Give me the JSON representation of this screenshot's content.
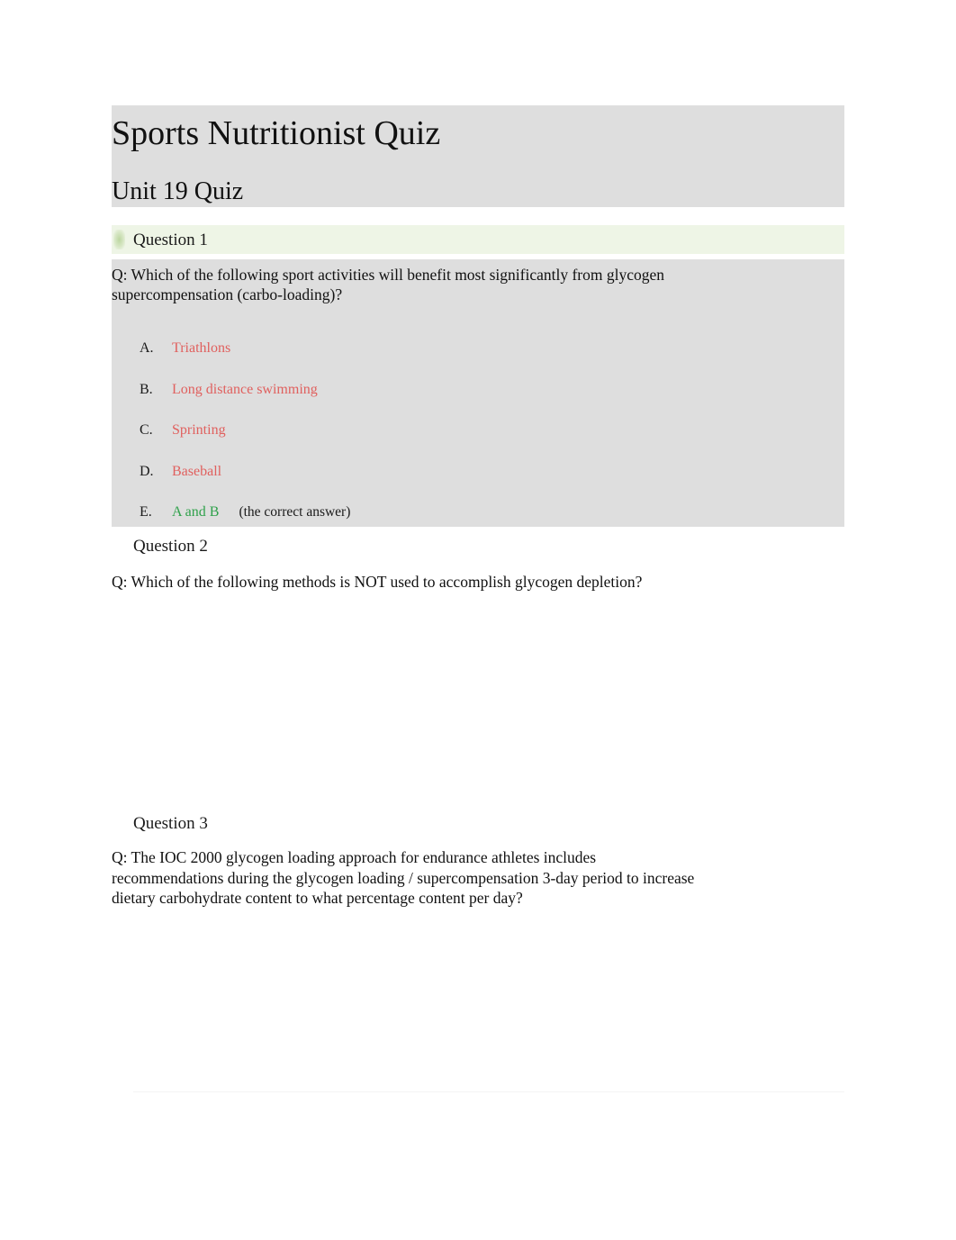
{
  "document": {
    "title": "Sports Nutritionist Quiz",
    "subtitle": "Unit 19 Quiz"
  },
  "questions": [
    {
      "heading": "Question 1",
      "prompt": "Q:  Which of the following sport activities will benefit most significantly from glycogen supercompensation (carbo-loading)?",
      "options": [
        {
          "letter": "A.",
          "text": "Triathlons",
          "correct": false,
          "note": ""
        },
        {
          "letter": "B.",
          "text": "Long distance swimming",
          "correct": false,
          "note": ""
        },
        {
          "letter": "C.",
          "text": "Sprinting",
          "correct": false,
          "note": ""
        },
        {
          "letter": "D.",
          "text": "Baseball",
          "correct": false,
          "note": ""
        },
        {
          "letter": "E.",
          "text": "A and B",
          "correct": true,
          "note": "(the correct answer)"
        }
      ]
    },
    {
      "heading": "Question 2",
      "prompt": "Q:  Which of the following methods is NOT used to accomplish glycogen depletion?",
      "options": []
    },
    {
      "heading": "Question 3",
      "prompt": "Q:  The IOC 2000 glycogen loading approach for endurance athletes includes recommendations during the glycogen loading / supercompensation 3-day period to increase dietary carbohydrate content to what percentage content per day?",
      "options": []
    }
  ],
  "colors": {
    "page_background": "#ffffff",
    "block_gray": "#dedede",
    "highlight_green": "#eef5e6",
    "option_red": "#e0605e",
    "option_green": "#2fa14b",
    "rule_gray": "#f4f4f4"
  }
}
